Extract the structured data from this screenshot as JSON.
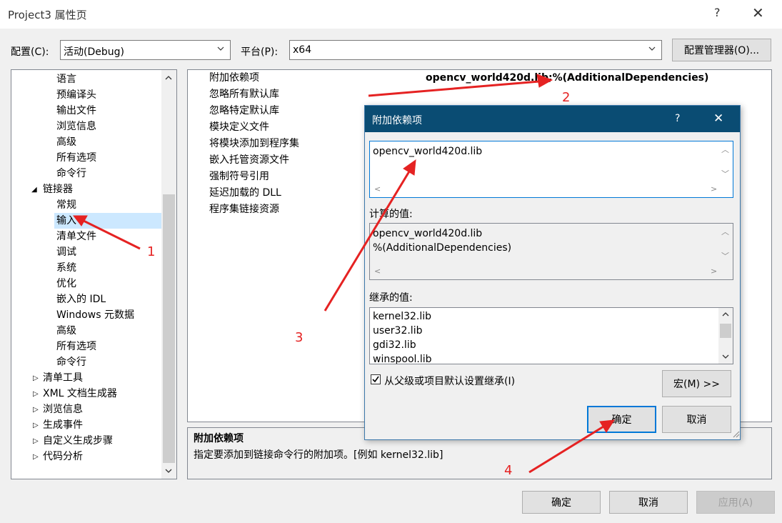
{
  "window": {
    "title": "Project3 属性页",
    "help": "?",
    "close": "✕"
  },
  "config": {
    "label": "配置(C):",
    "value": "活动(Debug)"
  },
  "platform": {
    "label": "平台(P):",
    "value": "x64"
  },
  "config_manager": "配置管理器(O)...",
  "tree": {
    "items": [
      "语言",
      "预编译头",
      "输出文件",
      "浏览信息",
      "高级",
      "所有选项",
      "命令行"
    ],
    "linker": "链接器",
    "linker_items": [
      "常规",
      "输入",
      "清单文件",
      "调试",
      "系统",
      "优化",
      "嵌入的 IDL",
      "Windows 元数据",
      "高级",
      "所有选项",
      "命令行"
    ],
    "collapsed": [
      "清单工具",
      "XML 文档生成器",
      "浏览信息",
      "生成事件",
      "自定义生成步骤",
      "代码分析"
    ]
  },
  "props": {
    "rows": [
      "附加依赖项",
      "忽略所有默认库",
      "忽略特定默认库",
      "模块定义文件",
      "将模块添加到程序集",
      "嵌入托管资源文件",
      "强制符号引用",
      "延迟加载的 DLL",
      "程序集链接资源"
    ],
    "value0": "opencv_world420d.lib;%(AdditionalDependencies)"
  },
  "description": {
    "title": "附加依赖项",
    "text": "指定要添加到链接命令行的附加项。[例如 kernel32.lib]"
  },
  "dialog": {
    "title": "附加依赖项",
    "help": "?",
    "close": "✕",
    "edit_text": "opencv_world420d.lib",
    "computed_label": "计算的值:",
    "computed_lines": [
      "opencv_world420d.lib",
      "%(AdditionalDependencies)"
    ],
    "inherited_label": "继承的值:",
    "inherited_lines": [
      "kernel32.lib",
      "user32.lib",
      "gdi32.lib",
      "winspool.lib"
    ],
    "inherit_checkbox": "从父级或项目默认设置继承(I)",
    "macro_button": "宏(M) >>",
    "ok": "确定",
    "cancel": "取消"
  },
  "footer": {
    "ok": "确定",
    "cancel": "取消",
    "apply": "应用(A)"
  },
  "annotations": [
    "1",
    "2",
    "3",
    "4"
  ]
}
